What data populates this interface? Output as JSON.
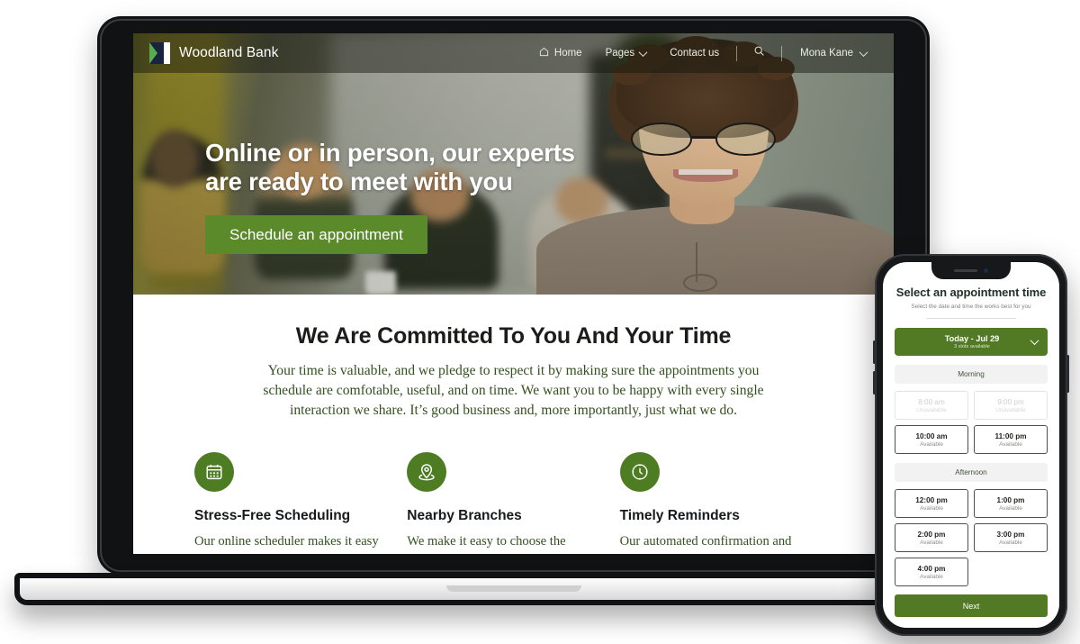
{
  "site": {
    "brand": {
      "name": "Woodland Bank",
      "logo_icon": "woodland-bank-logo",
      "colors": {
        "green": "#5aab4f",
        "navy": "#19253f",
        "white": "#ffffff"
      }
    },
    "nav": {
      "items": [
        {
          "label": "Home",
          "icon": "home-icon",
          "has_chevron": false
        },
        {
          "label": "Pages",
          "icon": null,
          "has_chevron": true
        },
        {
          "label": "Contact us",
          "icon": null,
          "has_chevron": false
        }
      ],
      "search_icon": "search-icon",
      "user": {
        "name": "Mona Kane",
        "chevron_icon": "chevron-down-icon"
      }
    },
    "hero": {
      "title_line1": "Online or in person, our experts",
      "title_line2": "are ready to meet with you",
      "cta_label": "Schedule an appointment",
      "cta_color": "#5a8a2a"
    },
    "section": {
      "title": "We Are Committed To You And Your Time",
      "body": "Your time is valuable, and we pledge to respect it by making sure the appointments you schedule are comfotable, useful, and on time. We want you to be happy with every single interaction we share. It’s good business and, more importantly, just what we do.",
      "body_color": "#33501f"
    },
    "features": [
      {
        "icon": "calendar-icon",
        "title": "Stress-Free Scheduling",
        "body": "Our online scheduler makes it easy to get the meeting time"
      },
      {
        "icon": "map-pin-icon",
        "title": "Nearby Branches",
        "body": "We make it easy to choose the location to meet that is"
      },
      {
        "icon": "clock-icon",
        "title": "Timely Reminders",
        "body": "Our automated confirmation and reminder messages helps"
      }
    ]
  },
  "phone": {
    "title": "Select an appointment time",
    "subtitle": "Select the date and time the works best for you",
    "date_picker": {
      "label": "Today - Jul 29",
      "slots_note": "3 slots available",
      "chevron_icon": "chevron-down-icon",
      "color": "#527a24"
    },
    "groups": [
      {
        "header": "Morning",
        "slots": [
          {
            "time": "8:00 am",
            "state": "Unavailable",
            "available": false
          },
          {
            "time": "9:00 pm",
            "state": "Unavailable",
            "available": false
          },
          {
            "time": "10:00 am",
            "state": "Available",
            "available": true
          },
          {
            "time": "11:00 pm",
            "state": "Available",
            "available": true
          }
        ]
      },
      {
        "header": "Afternoon",
        "slots": [
          {
            "time": "12:00 pm",
            "state": "Available",
            "available": true
          },
          {
            "time": "1:00 pm",
            "state": "Available",
            "available": true
          },
          {
            "time": "2:00 pm",
            "state": "Available",
            "available": true
          },
          {
            "time": "3:00 pm",
            "state": "Available",
            "available": true
          },
          {
            "time": "4:00 pm",
            "state": "Available",
            "available": true
          }
        ]
      }
    ],
    "next_label": "Next"
  }
}
